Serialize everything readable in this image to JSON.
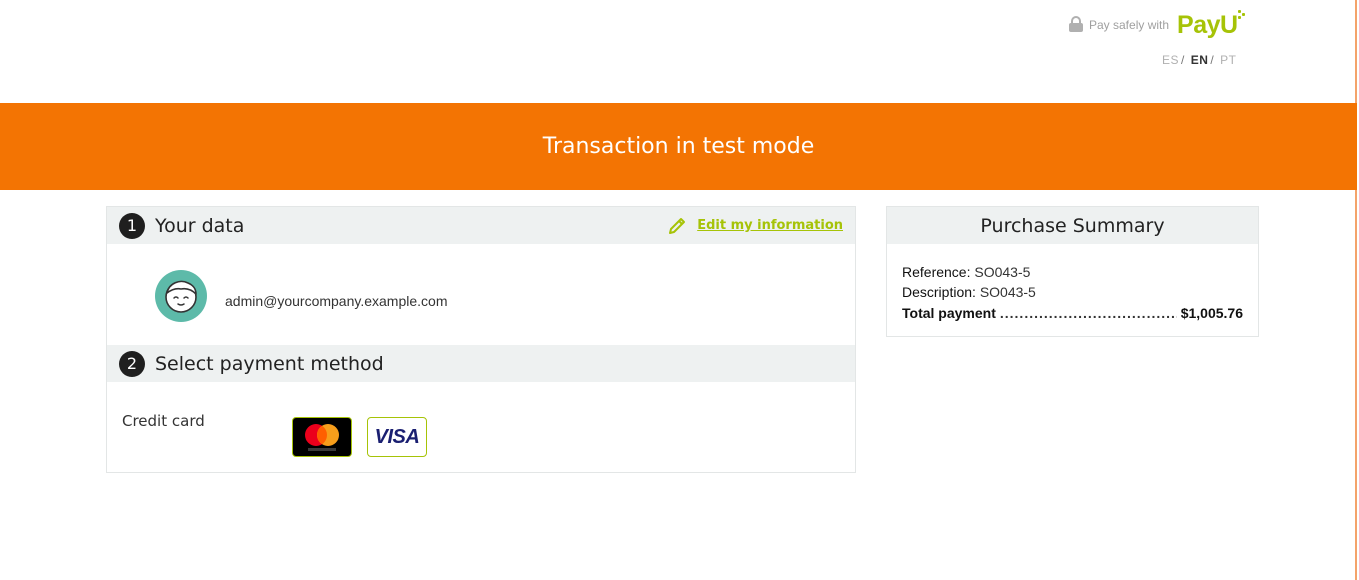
{
  "header": {
    "pay_safely_text": "Pay safely with",
    "brand": "PayU",
    "languages": [
      {
        "code": "ES",
        "active": false
      },
      {
        "code": "EN",
        "active": true
      },
      {
        "code": "PT",
        "active": false
      }
    ]
  },
  "banner": {
    "text": "Transaction in test mode",
    "color": "#f37403"
  },
  "your_data": {
    "step": "1",
    "title": "Your data",
    "edit_label": "Edit my information",
    "email": "admin@yourcompany.example.com"
  },
  "payment": {
    "step": "2",
    "title": "Select payment method",
    "method_label": "Credit card",
    "cards": [
      "mastercard-icon",
      "visa-icon"
    ]
  },
  "summary": {
    "title": "Purchase Summary",
    "reference_label": "Reference:",
    "reference_value": "SO043-5",
    "description_label": "Description:",
    "description_value": "SO043-5",
    "total_label": "Total payment",
    "total_value": "$1,005.76"
  },
  "colors": {
    "accent_green": "#a6c307",
    "banner_orange": "#f37403",
    "avatar_teal": "#5dbaa9"
  }
}
